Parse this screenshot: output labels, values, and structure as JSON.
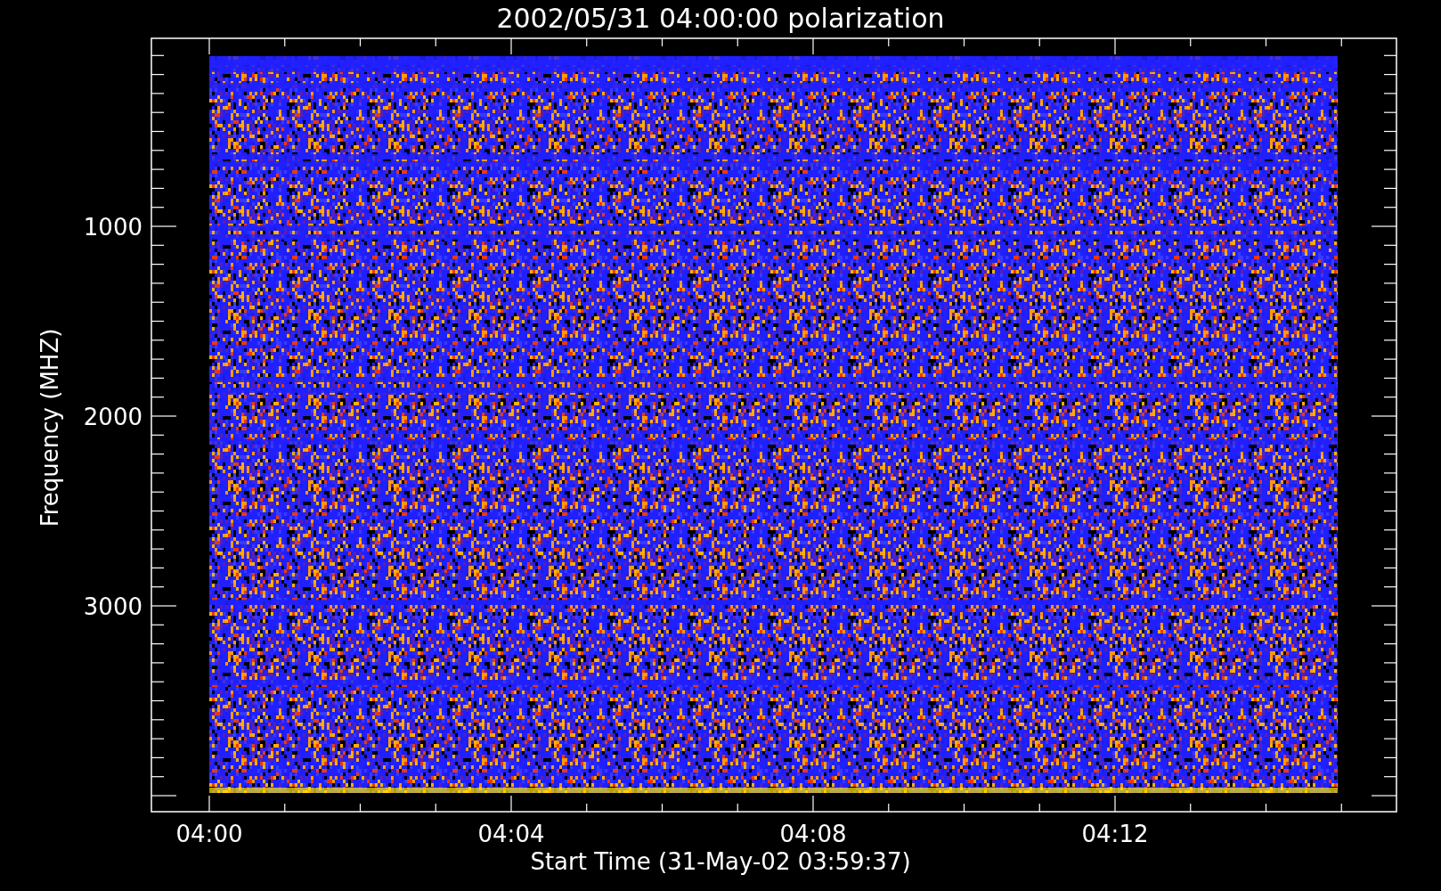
{
  "plot": {
    "title": "2002/05/31 04:00:00 polarization",
    "xlabel": "Start Time (31-May-02 03:59:37)",
    "ylabel": "Frequency (MHZ)",
    "xticks": [
      "04:00",
      "04:04",
      "04:08",
      "04:12"
    ],
    "yticks": [
      "1000",
      "2000",
      "3000"
    ]
  }
}
